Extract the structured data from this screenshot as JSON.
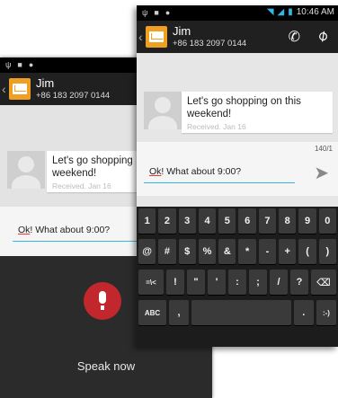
{
  "colors": {
    "accent": "#33b5e5",
    "mic": "#c1272d",
    "envelope": "#f0a020"
  },
  "back": {
    "contact": {
      "name": "Jim",
      "number": "+86 183 2097 0144"
    },
    "message": {
      "line1": "Let's go shopping",
      "line2": "weekend!",
      "meta": "Received. Jan 16"
    },
    "compose": {
      "prefix": "Ok",
      "rest": "! What about 9:00?"
    },
    "voice": {
      "label": "Speak now",
      "icon": "microphone-icon"
    }
  },
  "front": {
    "status": {
      "time": "10:46 AM"
    },
    "contact": {
      "name": "Jim",
      "number": "+86 183 2097 0144"
    },
    "message": {
      "line1": "Let's go shopping on this",
      "line2": "weekend!",
      "meta": "Received. Jan 16"
    },
    "compose": {
      "prefix": "Ok",
      "rest": "! What about 9:00?",
      "counter": "140/1"
    },
    "keyboard": {
      "row1": [
        "1",
        "2",
        "3",
        "4",
        "5",
        "6",
        "7",
        "8",
        "9",
        "0"
      ],
      "row2": [
        "@",
        "#",
        "$",
        "%",
        "&",
        "*",
        "-",
        "+",
        "(",
        ")"
      ],
      "row3": [
        "=\\<",
        "!",
        "\"",
        "'",
        ":",
        ";",
        "/",
        "?",
        "⌫"
      ],
      "row4": [
        "ABC",
        ",",
        "",
        ".",
        ":-)"
      ]
    }
  }
}
